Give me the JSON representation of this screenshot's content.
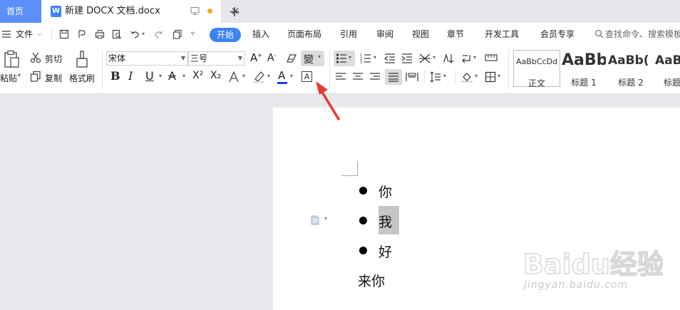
{
  "titlebar": {
    "home_tab": "首页",
    "doc_tab": "新建 DOCX 文档.docx",
    "doc_icon_letter": "W",
    "close": "✕",
    "new_tab": "+"
  },
  "menubar": {
    "file": "文件",
    "tabs": [
      "开始",
      "插入",
      "页面布局",
      "引用",
      "审阅",
      "视图",
      "章节",
      "开发工具",
      "会员专享"
    ],
    "search": "查找命令、搜索模板"
  },
  "ribbon": {
    "paste": "粘贴",
    "cut": "剪切",
    "copy": "复制",
    "format_painter": "格式刷",
    "font_name": "宋体",
    "font_size": "三号",
    "bold": "B",
    "italic": "I",
    "underline": "U",
    "superscript": "X²",
    "subscript": "X₂",
    "styles": [
      {
        "sample": "AaBbCcDd",
        "name": "正文"
      },
      {
        "sample": "AaBb",
        "name": "标题 1"
      },
      {
        "sample": "AaBb(",
        "name": "标题 2"
      },
      {
        "sample": "AaBb",
        "name": "标题"
      }
    ]
  },
  "document": {
    "bullets": [
      "你",
      "我",
      "好"
    ],
    "plain": "来你"
  },
  "watermark": {
    "brand": "Baidu经验",
    "url": "jingyan.baidu.com"
  },
  "colors": {
    "accent": "#3d83f5",
    "home_tab": "#5b8ff9",
    "arrow": "#e8392e",
    "font_color_bar": "#1a3fd8"
  }
}
